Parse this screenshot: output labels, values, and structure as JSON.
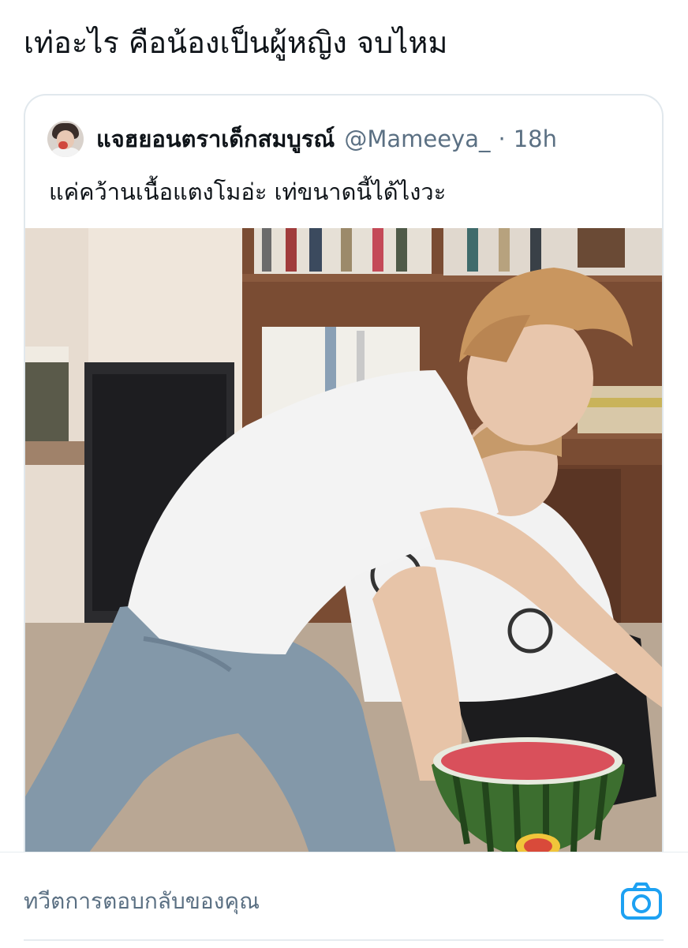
{
  "tweet": {
    "text": "เท่อะไร คือน้องเป็นผู้หญิง จบไหม"
  },
  "quoted_tweet": {
    "author_name": "แจฮยอนตราเด็กสมบูรณ์",
    "handle": "@Mameeya_",
    "separator": "·",
    "time": "18h",
    "text": "แค่คว้านเนื้อแตงโมอ่ะ เท่ขนาดนี้ได้ไงวะ"
  },
  "reply": {
    "placeholder": "ทวีตการตอบกลับของคุณ"
  },
  "colors": {
    "accent": "#1da1f2",
    "secondary_text": "#5b7083",
    "border": "#e1e8ed"
  }
}
